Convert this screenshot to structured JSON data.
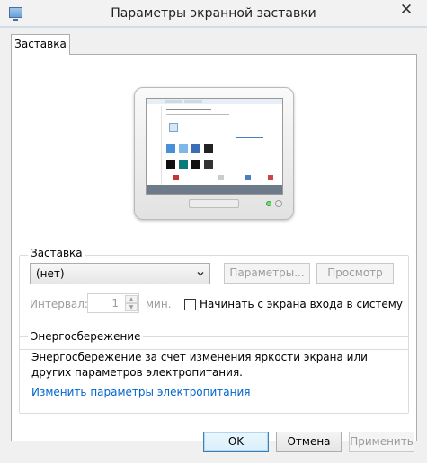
{
  "window": {
    "title": "Параметры экранной заставки",
    "close_glyph": "✕"
  },
  "tabs": [
    {
      "label": "Заставка",
      "active": true
    }
  ],
  "screensaver": {
    "group_label": "Заставка",
    "selected": "(нет)",
    "settings_button": "Параметры...",
    "preview_button": "Просмотр",
    "interval_label": "Интервал:",
    "interval_value": "1",
    "minutes_label": "мин.",
    "logon_checkbox_label": "Начинать с экрана входа в систему",
    "logon_checked": false
  },
  "power": {
    "group_label": "Энергосбережение",
    "description": "Энергосбережение за счет изменения яркости экрана или других параметров электропитания.",
    "link": "Изменить параметры электропитания"
  },
  "buttons": {
    "ok": "OK",
    "cancel": "Отмена",
    "apply": "Применить"
  },
  "colors": {
    "accent_link": "#0066cc",
    "default_button_border": "#3c7fb1",
    "power_led": "#6de06d"
  },
  "icons": [
    "monitor-icon",
    "chevron-down-icon",
    "close-icon"
  ]
}
